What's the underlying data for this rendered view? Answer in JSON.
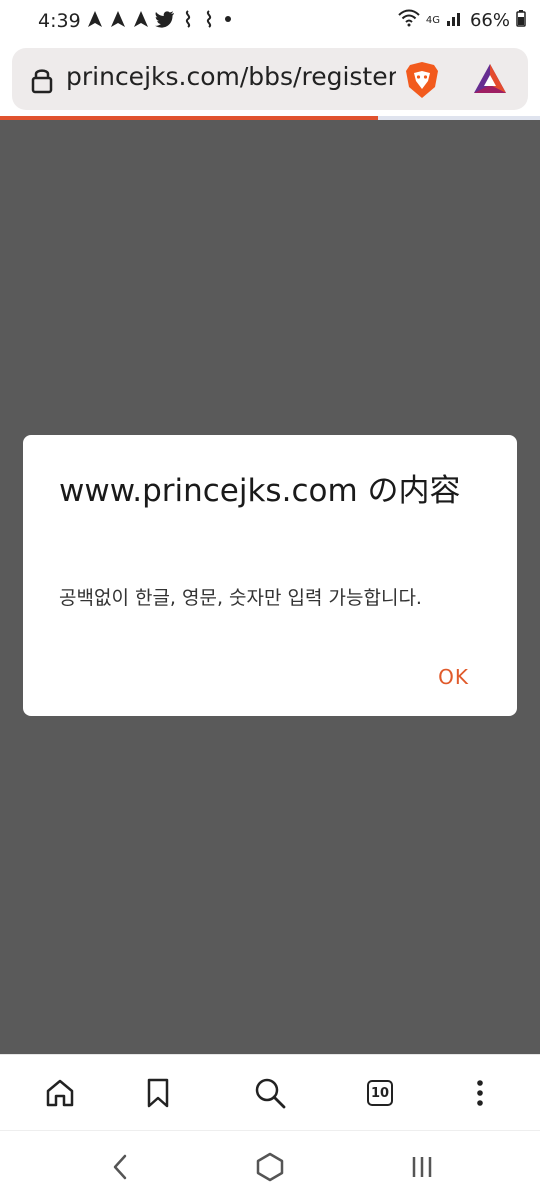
{
  "status_bar": {
    "time": "4:39",
    "battery": "66%",
    "network": "4G",
    "notification_icons": [
      "navigation-arrow-icon",
      "navigation-arrow-icon",
      "navigation-arrow-icon",
      "twitter-icon",
      "app-notification-icon",
      "app-notification-icon",
      "more-dot-icon"
    ]
  },
  "browser": {
    "url": "princejks.com/bbs/register",
    "load_progress": 0.7,
    "brand_color": "#e0522e"
  },
  "dialog": {
    "title": "www.princejks.com の内容",
    "message": "공백없이 한글, 영문, 숫자만 입력 가능합니다.",
    "ok_label": "OK",
    "ok_color": "#e05a2b"
  },
  "toolbar": {
    "tab_count": "10",
    "items": [
      "home-icon",
      "bookmark-icon",
      "search-icon",
      "tab-counter",
      "menu-icon"
    ]
  },
  "nav_bar": {
    "items": [
      "back-icon",
      "home-button-icon",
      "recents-icon"
    ]
  }
}
